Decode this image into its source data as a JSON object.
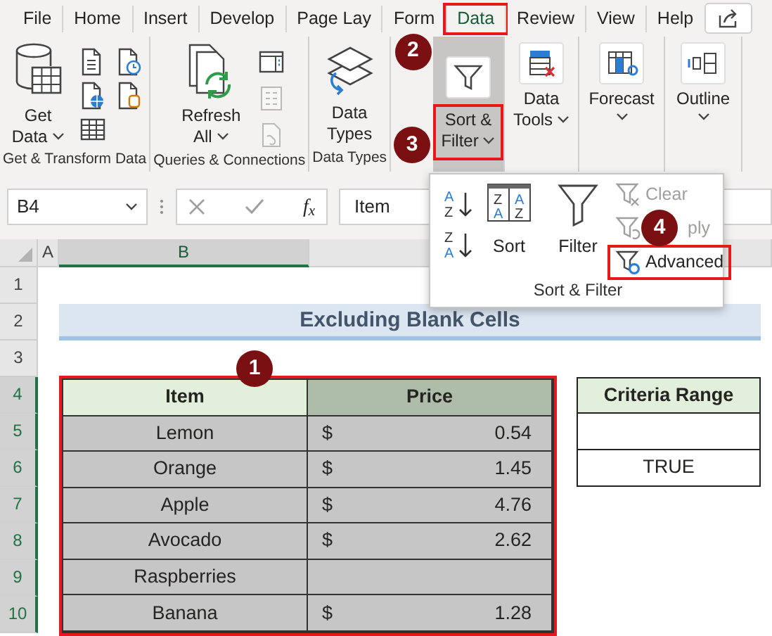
{
  "menu_tabs": [
    {
      "label": "File",
      "selected": false
    },
    {
      "label": "Home",
      "selected": false
    },
    {
      "label": "Insert",
      "selected": false
    },
    {
      "label": "Develop",
      "selected": false
    },
    {
      "label": "Page Lay",
      "selected": false
    },
    {
      "label": "Form",
      "selected": false
    },
    {
      "label": "Data",
      "selected": true,
      "marker": "2"
    },
    {
      "label": "Review",
      "selected": false
    },
    {
      "label": "View",
      "selected": false
    },
    {
      "label": "Help",
      "selected": false
    }
  ],
  "ribbon_groups": [
    {
      "kind": "get-transform",
      "label": "Get & Transform Data",
      "button": {
        "label": "Get Data",
        "dropdown": true
      },
      "tools": [
        {
          "disabled": false
        },
        {
          "disabled": false
        },
        {
          "disabled": false
        },
        {
          "disabled": false
        },
        {
          "disabled": false
        }
      ]
    },
    {
      "kind": "queries",
      "label": "Queries & Connections",
      "button": {
        "label": "Refresh All",
        "dropdown": true
      },
      "tools": [
        {
          "disabled": false
        },
        {
          "disabled": true
        },
        {
          "disabled": true
        }
      ]
    },
    {
      "kind": "data-types",
      "label": "Data Types",
      "button": {
        "label": "Data Types"
      }
    },
    {
      "kind": "sort-filter",
      "highlighted": true,
      "button": {
        "label": "Sort & Filter",
        "dropdown": true,
        "marker": "3"
      }
    },
    {
      "kind": "data-tools",
      "button": {
        "label": "Data Tools",
        "dropdown": true
      }
    },
    {
      "kind": "forecast",
      "button": {
        "label": "Forecast",
        "dropdown": true
      }
    },
    {
      "kind": "outline",
      "button": {
        "label": "Outline",
        "dropdown": true
      }
    }
  ],
  "formula_bar": {
    "name_box": "B4",
    "function_label": "f$_{x}$",
    "formula": "Item"
  },
  "sort_filter_panel": {
    "label": "Sort & Filter",
    "sort_icons": [
      {
        "letters": [
          "A",
          "Z"
        ]
      },
      {
        "letters": [
          "Z",
          "A"
        ]
      }
    ],
    "sort": {
      "label": "Sort",
      "letters": [
        "Z",
        "A",
        "A",
        "Z"
      ]
    },
    "filter": {
      "label": "Filter"
    },
    "actions": [
      {
        "label": "Clear",
        "disabled": true
      },
      {
        "label": "ply",
        "disabled": true,
        "covered": true
      },
      {
        "label": "Advanced",
        "disabled": false,
        "marker": "4"
      }
    ]
  },
  "sheet": {
    "columns": [
      {
        "label": "A",
        "selected": false
      },
      {
        "label": "B",
        "selected": true
      }
    ],
    "rows": [
      {
        "label": "1",
        "selected": false
      },
      {
        "label": "2",
        "selected": false
      },
      {
        "label": "3",
        "selected": false
      },
      {
        "label": "4",
        "selected": true
      },
      {
        "label": "5",
        "selected": true
      },
      {
        "label": "6",
        "selected": true
      },
      {
        "label": "7",
        "selected": true
      },
      {
        "label": "8",
        "selected": true
      },
      {
        "label": "9",
        "selected": true
      },
      {
        "label": "10",
        "selected": true
      }
    ],
    "title": "Excluding Blank Cells",
    "table": {
      "marker": "1",
      "columns": [
        {
          "label": "Item",
          "active": true
        },
        {
          "label": "Price",
          "active": false
        }
      ],
      "rows": [
        {
          "item": "Lemon",
          "currency": "$",
          "price": "0.54",
          "selected": true
        },
        {
          "item": "Orange",
          "currency": "$",
          "price": "1.45",
          "selected": true
        },
        {
          "item": "Apple",
          "currency": "$",
          "price": "4.76",
          "selected": true
        },
        {
          "item": "Avocado",
          "currency": "$",
          "price": "2.62",
          "selected": true
        },
        {
          "item": "Raspberries",
          "selected": true
        },
        {
          "item": "Banana",
          "currency": "$",
          "price": "1.28",
          "selected": true
        }
      ]
    },
    "criteria": {
      "header": "Criteria Range",
      "cells": [
        {
          "blank": true
        },
        {
          "value": "TRUE"
        }
      ]
    }
  }
}
